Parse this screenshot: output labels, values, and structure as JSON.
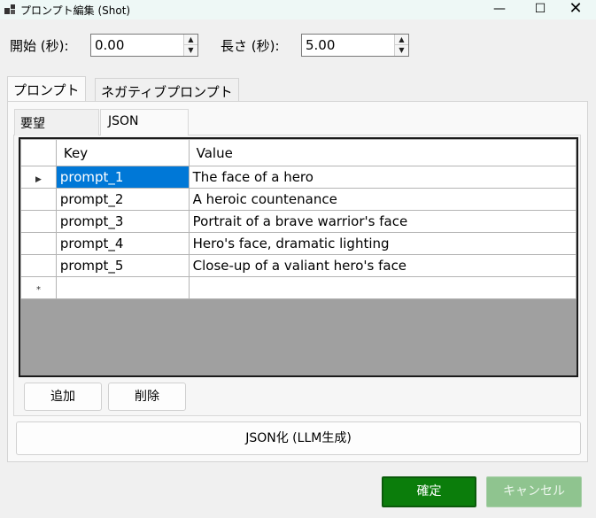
{
  "window": {
    "title": "プロンプト編集 (Shot)",
    "icons": {
      "app": "app-icon",
      "minimize": "minimize-icon",
      "maximize": "maximize-icon",
      "close": "close-icon"
    },
    "controls": {
      "minimize": "—",
      "maximize": "☐",
      "close": "✕"
    }
  },
  "timing": {
    "start_label": "開始 (秒):",
    "start_value": "0.00",
    "length_label": "長さ (秒):",
    "length_value": "5.00"
  },
  "tabs": [
    {
      "label": "プロンプト",
      "active": true
    },
    {
      "label": "ネガティブプロンプト",
      "active": false
    }
  ],
  "subtabs": [
    {
      "label": "要望",
      "active": false
    },
    {
      "label": "JSON",
      "active": true
    }
  ],
  "grid": {
    "columns": [
      "Key",
      "Value"
    ],
    "rows": [
      {
        "key": "prompt_1",
        "value": "The face of a hero"
      },
      {
        "key": "prompt_2",
        "value": "A heroic countenance"
      },
      {
        "key": "prompt_3",
        "value": "Portrait of a brave warrior's face"
      },
      {
        "key": "prompt_4",
        "value": "Hero's face, dramatic lighting"
      },
      {
        "key": "prompt_5",
        "value": "Close-up of a valiant hero's face"
      }
    ],
    "selected_row": 0,
    "current_row_marker": "▶",
    "new_row_marker": "*"
  },
  "buttons": {
    "add": "追加",
    "delete": "削除",
    "json_generate": "JSON化 (LLM生成)",
    "ok": "確定",
    "cancel": "キャンセル"
  },
  "colors": {
    "selection": "#0078d7",
    "ok_button": "#0b7d0b",
    "cancel_button_disabled": "#8fc48f",
    "grid_background": "#a0a0a0"
  }
}
